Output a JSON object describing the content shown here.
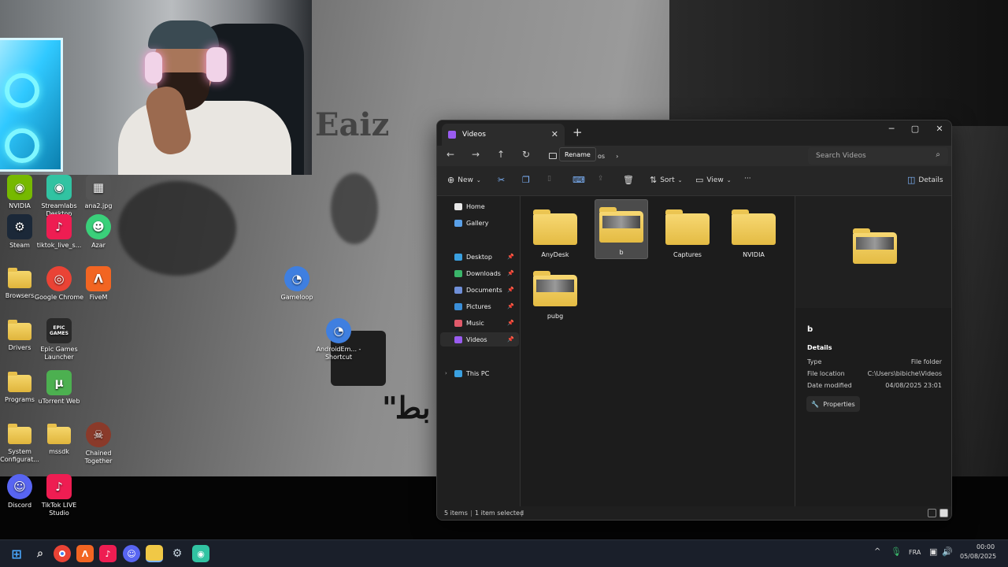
{
  "desktop": {
    "icons": [
      {
        "label": "NVIDIA",
        "icon": "nvidia-icon",
        "color": "#76b900"
      },
      {
        "label": "Streamlabs Desktop",
        "icon": "streamlabs-icon",
        "color": "#31c3a2"
      },
      {
        "label": "ana2.jpg",
        "icon": "image-file-icon",
        "color": "#555555"
      },
      {
        "label": "Steam",
        "icon": "steam-icon",
        "color": "#1b2838"
      },
      {
        "label": "tiktok_live_s...",
        "icon": "tiktok-icon",
        "color": "#ee1d52"
      },
      {
        "label": "Azar",
        "icon": "azar-icon",
        "color": "#3ad07a"
      },
      {
        "label": "Browsers",
        "icon": "folder-icon",
        "color": "#f0c846"
      },
      {
        "label": "Google Chrome",
        "icon": "chrome-icon",
        "color": "#ea4335"
      },
      {
        "label": "FiveM",
        "icon": "fivem-icon",
        "color": "#f26522"
      },
      {
        "label": "Gameloop",
        "icon": "gameloop-icon",
        "color": "#3f7fe0"
      },
      {
        "label": "Drivers",
        "icon": "folder-icon",
        "color": "#f0c846"
      },
      {
        "label": "Epic Games Launcher",
        "icon": "epic-games-icon",
        "color": "#2a2a2a"
      },
      {
        "label": "AndroidEm... - Shortcut",
        "icon": "android-emulator-icon",
        "color": "#3f7fe0"
      },
      {
        "label": "Programs",
        "icon": "folder-icon",
        "color": "#f0c846"
      },
      {
        "label": "uTorrent Web",
        "icon": "utorrent-icon",
        "color": "#4cb050"
      },
      {
        "label": "System Configurat...",
        "icon": "folder-icon",
        "color": "#f0c846"
      },
      {
        "label": "mssdk",
        "icon": "folder-icon",
        "color": "#f0c846"
      },
      {
        "label": "Chained Together",
        "icon": "chained-together-icon",
        "color": "#8a3a2a"
      },
      {
        "label": "Discord",
        "icon": "discord-icon",
        "color": "#5865f2"
      },
      {
        "label": "TikTok LIVE Studio",
        "icon": "tiktok-icon",
        "color": "#ee1d52"
      }
    ],
    "epic_text": "EPIC GAMES"
  },
  "explorer": {
    "tab_title": "Videos",
    "tab_close": "✕",
    "tab_add": "+",
    "window_controls": {
      "minimize": "─",
      "maximize": "▢",
      "close": "✕"
    },
    "nav": {
      "back": "←",
      "forward": "→",
      "up": "↑",
      "refresh": "↻"
    },
    "address_tail": "os",
    "address_chevron": "›",
    "rename_tooltip": "Rename",
    "search_placeholder": "Search Videos",
    "toolbar": {
      "new_label": "New",
      "sort_label": "Sort",
      "view_label": "View",
      "more_label": "···",
      "details_label": "Details"
    },
    "nav_pane": [
      {
        "label": "Home",
        "icon": "home-icon",
        "color": "#e8e8e8",
        "pinned": false
      },
      {
        "label": "Gallery",
        "icon": "gallery-icon",
        "color": "#5aa0e8",
        "pinned": false
      },
      {
        "label": "Desktop",
        "icon": "desktop-icon",
        "color": "#3aa0e0",
        "pinned": true
      },
      {
        "label": "Downloads",
        "icon": "downloads-icon",
        "color": "#3ab56a",
        "pinned": true
      },
      {
        "label": "Documents",
        "icon": "documents-icon",
        "color": "#6f8fd8",
        "pinned": true
      },
      {
        "label": "Pictures",
        "icon": "pictures-icon",
        "color": "#3a8ed8",
        "pinned": true
      },
      {
        "label": "Music",
        "icon": "music-icon",
        "color": "#e05a6a",
        "pinned": true
      },
      {
        "label": "Videos",
        "icon": "videos-icon",
        "color": "#9a5cf0",
        "pinned": true
      },
      {
        "label": "This PC",
        "icon": "this-pc-icon",
        "color": "#3aa0e0",
        "pinned": false
      }
    ],
    "pin_glyph": "📌",
    "expand_glyph": "›",
    "files": [
      {
        "name": "AnyDesk",
        "thumb": false,
        "selected": false
      },
      {
        "name": "b",
        "thumb": true,
        "selected": true
      },
      {
        "name": "Captures",
        "thumb": false,
        "selected": false
      },
      {
        "name": "NVIDIA",
        "thumb": false,
        "selected": false
      },
      {
        "name": "pubg",
        "thumb": true,
        "selected": false
      }
    ],
    "details_pane": {
      "name": "b",
      "section": "Details",
      "rows": [
        {
          "label": "Type",
          "value": "File folder"
        },
        {
          "label": "File location",
          "value": "C:\\Users\\bibiche\\Videos"
        },
        {
          "label": "Date modified",
          "value": "04/08/2025 23:01"
        }
      ],
      "properties_label": "Properties"
    },
    "status": {
      "items": "5 items",
      "selected": "1 item selected"
    }
  },
  "taskbar": {
    "language": "FRA",
    "time": "00:00",
    "date": "05/08/2025",
    "tray_chevron": "^"
  }
}
